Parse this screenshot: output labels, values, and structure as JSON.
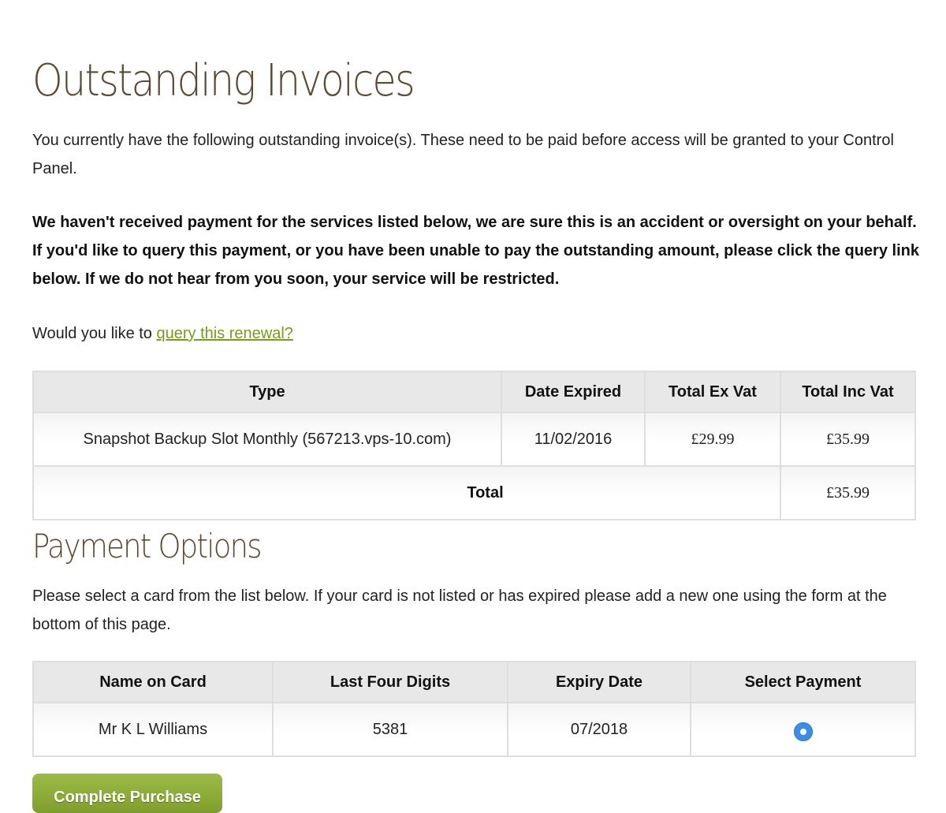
{
  "page": {
    "title": "Outstanding Invoices"
  },
  "intro": {
    "text": "You currently have the following outstanding invoice(s). These need to be paid before access will be granted to your Control Panel."
  },
  "notice": {
    "text": "We haven't received payment for the services listed below, we are sure this is an accident or oversight on your behalf. If you'd like to query this payment, or you have been unable to pay the outstanding amount, please click the query link below. If we do not hear from you soon, your service will be restricted."
  },
  "query": {
    "prefix": "Would you like to ",
    "link_label": "query this renewal?"
  },
  "invoices": {
    "headers": {
      "type": "Type",
      "date_expired": "Date Expired",
      "total_ex_vat": "Total Ex Vat",
      "total_inc_vat": "Total Inc Vat"
    },
    "rows": [
      {
        "type": "Snapshot Backup Slot Monthly (567213.vps-10.com)",
        "date_expired": "11/02/2016",
        "total_ex_vat": "£29.99",
        "total_inc_vat": "£35.99"
      }
    ],
    "total_label": "Total",
    "total_value": "£35.99"
  },
  "payment": {
    "title": "Payment Options",
    "text": "Please select a card from the list below. If your card is not listed or has expired please add a new one using the form at the bottom of this page.",
    "headers": {
      "name": "Name on Card",
      "last_four": "Last Four Digits",
      "expiry": "Expiry Date",
      "select": "Select Payment"
    },
    "cards": [
      {
        "name": "Mr K L Williams",
        "last_four": "5381",
        "expiry": "07/2018",
        "selected": true
      }
    ]
  },
  "actions": {
    "complete_label": "Complete Purchase"
  },
  "colors": {
    "heading": "#5a4a35",
    "link": "#7a9a1f",
    "button": "#8aab37",
    "radio": "#3a8ee6"
  }
}
